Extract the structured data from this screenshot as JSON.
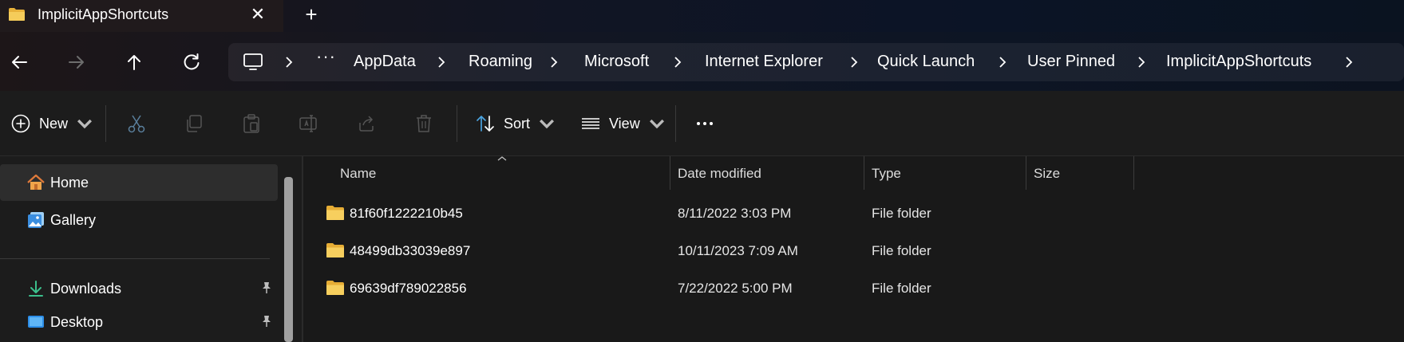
{
  "tab": {
    "title": "ImplicitAppShortcuts",
    "close_symbol": "✕",
    "new_tab_symbol": "+"
  },
  "address": {
    "overflow": "···",
    "crumbs": [
      "AppData",
      "Roaming",
      "Microsoft",
      "Internet Explorer",
      "Quick Launch",
      "User Pinned",
      "ImplicitAppShortcuts"
    ]
  },
  "toolbar": {
    "new_label": "New",
    "sort_label": "Sort",
    "view_label": "View",
    "more_label": "···"
  },
  "sidebar": {
    "items": [
      {
        "label": "Home",
        "icon": "home-icon",
        "selected": true
      },
      {
        "label": "Gallery",
        "icon": "gallery-icon"
      },
      {
        "label": "Downloads",
        "icon": "download-icon",
        "pinned": true
      },
      {
        "label": "Desktop",
        "icon": "desktop-icon",
        "pinned": true
      }
    ]
  },
  "columns": {
    "name": "Name",
    "date": "Date modified",
    "type": "Type",
    "size": "Size"
  },
  "files": [
    {
      "name": "81f60f1222210b45",
      "date": "8/11/2022 3:03 PM",
      "type": "File folder",
      "size": ""
    },
    {
      "name": "48499db33039e897",
      "date": "10/11/2023 7:09 AM",
      "type": "File folder",
      "size": ""
    },
    {
      "name": "69639df789022856",
      "date": "7/22/2022 5:00 PM",
      "type": "File folder",
      "size": ""
    }
  ],
  "colors": {
    "folder": "#f2c54d",
    "accent": "#4aa3df",
    "background": "#191919"
  }
}
